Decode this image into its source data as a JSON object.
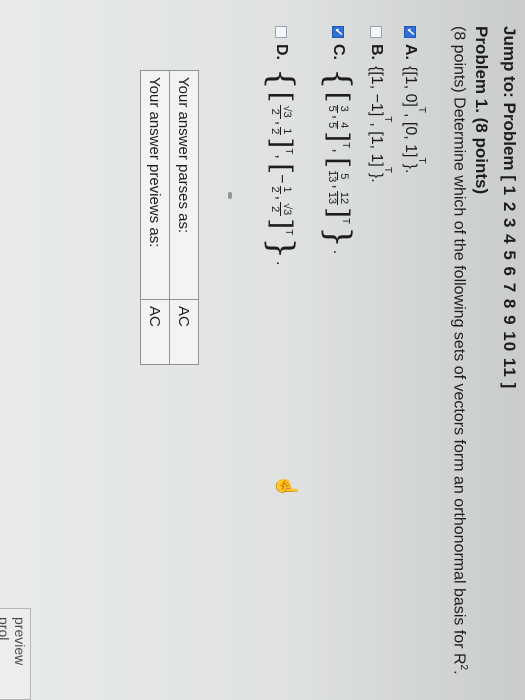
{
  "nav": {
    "jump_label": "Jump to: Problem [",
    "problem_numbers": "1 2 3 4 5 6 7 8 9 10 11",
    "jump_close": "]"
  },
  "problem": {
    "title": "Problem 1. (8 points)",
    "description": "(8 points) Determine which of the following sets of vectors form an orthonormal basis for R",
    "description_sup": "2",
    "description_end": "."
  },
  "options": {
    "a": {
      "letter": "A.",
      "text": "{[1, 0]",
      "t1": "T",
      "mid": ", [0, 1]",
      "t2": "T",
      "end": "}.",
      "checked": true
    },
    "b": {
      "letter": "B.",
      "text": "{[1, −1]",
      "t1": "T",
      "mid": ", [1, 1]",
      "t2": "T",
      "end": "}.",
      "checked": false
    },
    "c": {
      "letter": "C.",
      "checked": true,
      "f1n": "3",
      "f1d": "5",
      "f2n": "4",
      "f2d": "5",
      "f3n": "5",
      "f3d": "13",
      "f4n": "12",
      "f4d": "13",
      "t": "T"
    },
    "d": {
      "letter": "D.",
      "checked": false,
      "f1n": "√3",
      "f1d": "2",
      "f2n": "1",
      "f2d": "2",
      "neg": "−",
      "f3n": "1",
      "f3d": "2",
      "f4n": "√3",
      "f4d": "2",
      "t": "T"
    }
  },
  "results": {
    "parses_label": "Your answer parses as:",
    "parses_value": "AC",
    "previews_label": "Your answer previews as:",
    "previews_value": "AC"
  },
  "preview_button": "preview prol",
  "check_glyph": "✓",
  "cursor_glyph": "☝"
}
